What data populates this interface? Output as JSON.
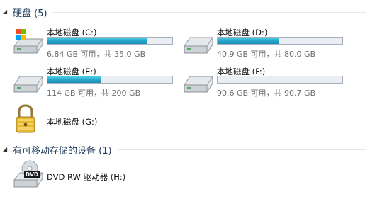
{
  "groups": {
    "hard_disks": {
      "title": "硬盘 (5)",
      "toggle": "◢"
    },
    "removable": {
      "title": "有可移动存储的设备 (1)",
      "toggle": "◢"
    }
  },
  "drives": [
    {
      "name": "本地磁盘 (C:)",
      "free": "6.84 GB 可用，共 35.0 GB",
      "used_fraction": 0.8,
      "icon": "windows-drive-icon"
    },
    {
      "name": "本地磁盘 (D:)",
      "free": "40.9 GB 可用，共 80.0 GB",
      "used_fraction": 0.49,
      "icon": "hard-drive-icon"
    },
    {
      "name": "本地磁盘 (E:)",
      "free": "114 GB 可用，共 200 GB",
      "used_fraction": 0.43,
      "icon": "hard-drive-icon"
    },
    {
      "name": "本地磁盘 (F:)",
      "free": "90.6 GB 可用，共 90.7 GB",
      "used_fraction": 0.001,
      "icon": "hard-drive-icon"
    },
    {
      "name": "本地磁盘 (G:)",
      "icon": "locked-drive-icon"
    }
  ],
  "removable_drives": [
    {
      "name": "DVD RW 驱动器 (H:)",
      "icon": "dvd-drive-icon",
      "badge": "DVD"
    }
  ]
}
